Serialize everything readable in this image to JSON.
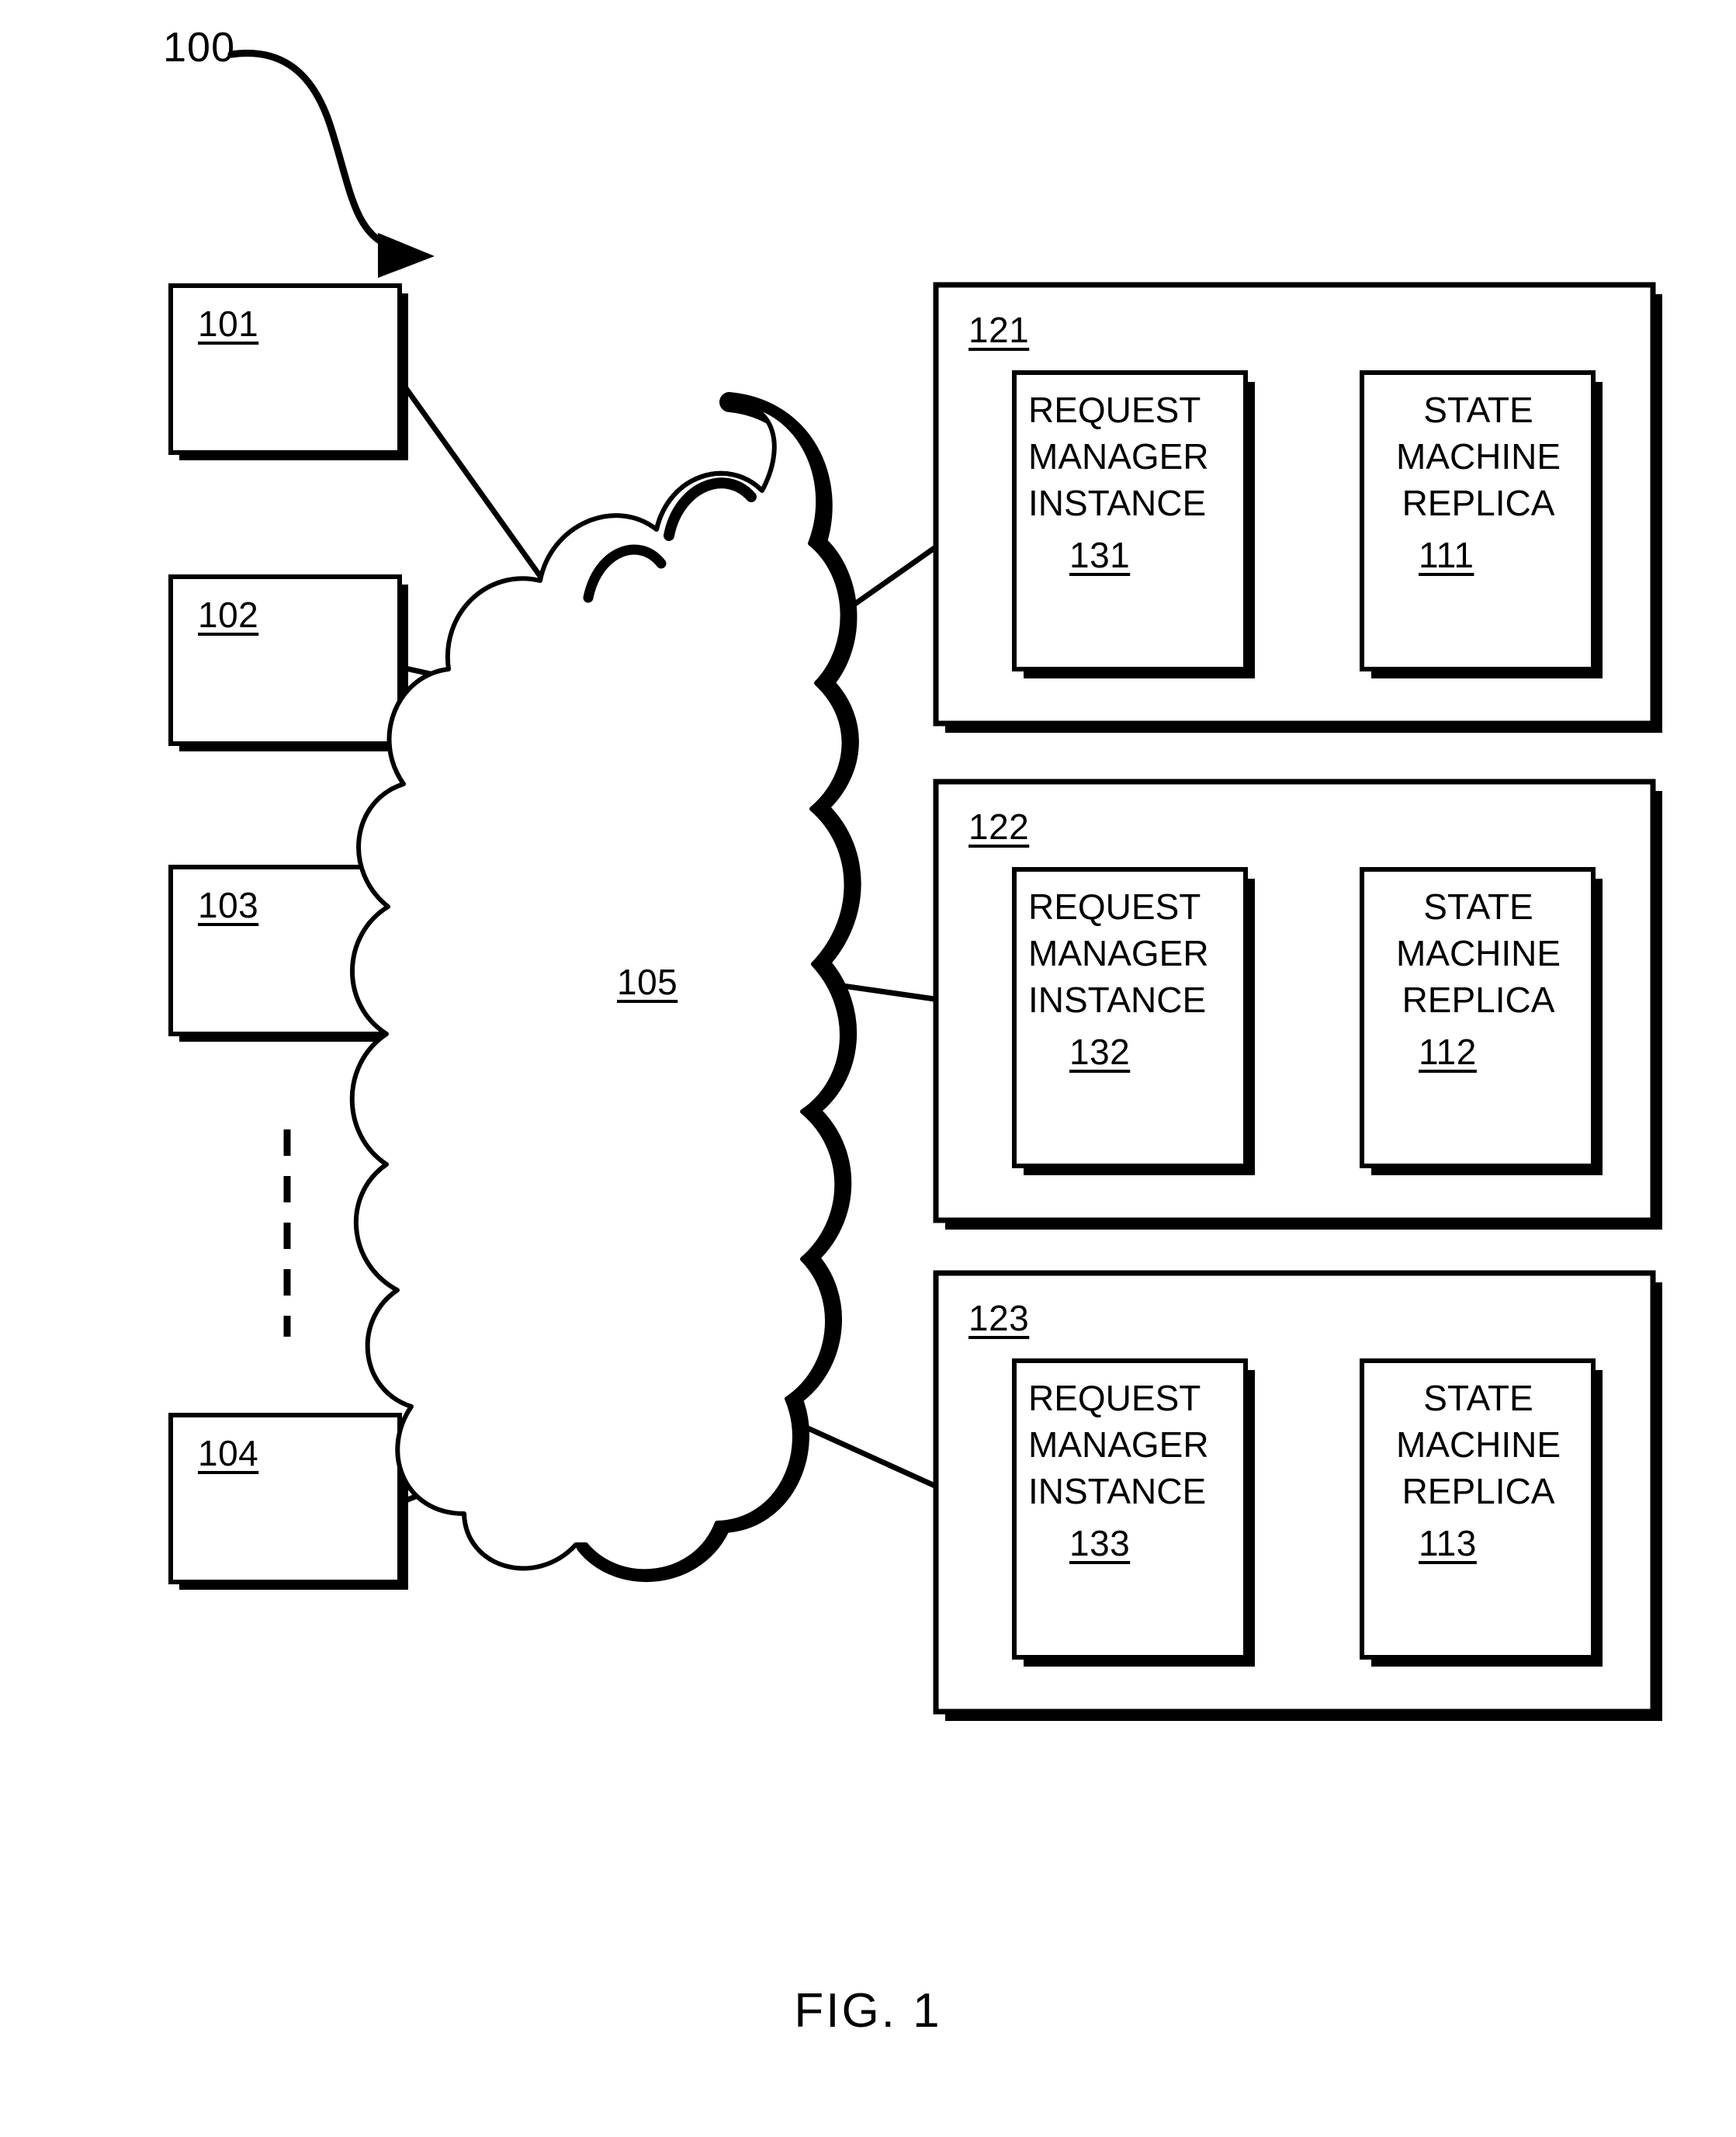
{
  "figure": {
    "caption": "FIG. 1",
    "system_label": "100",
    "network_label": "105"
  },
  "clients": [
    {
      "ref": "101"
    },
    {
      "ref": "102"
    },
    {
      "ref": "103"
    },
    {
      "ref": "104"
    }
  ],
  "ellipsis": {
    "glyph": "vertical-dashed-line"
  },
  "servers": [
    {
      "ref": "121",
      "request_manager": {
        "title": "REQUEST\nMANAGER\nINSTANCE",
        "ref": "131"
      },
      "state_machine": {
        "title": "STATE\nMACHINE\nREPLICA",
        "ref": "111"
      }
    },
    {
      "ref": "122",
      "request_manager": {
        "title": "REQUEST\nMANAGER\nINSTANCE",
        "ref": "132"
      },
      "state_machine": {
        "title": "STATE\nMACHINE\nREPLICA",
        "ref": "112"
      }
    },
    {
      "ref": "123",
      "request_manager": {
        "title": "REQUEST\nMANAGER\nINSTANCE",
        "ref": "133"
      },
      "state_machine": {
        "title": "STATE\nMACHINE\nREPLICA",
        "ref": "113"
      }
    }
  ],
  "colors": {
    "ink": "#000000",
    "paper": "#ffffff"
  }
}
